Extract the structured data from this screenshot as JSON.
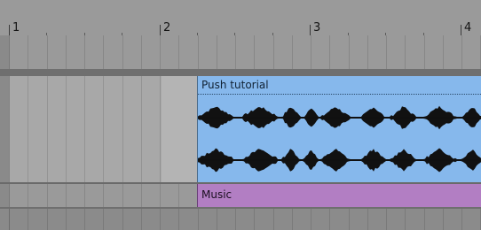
{
  "ruler": {
    "bars": [
      "1",
      "2",
      "3",
      "4"
    ]
  },
  "clips": {
    "audio": {
      "name": "Push tutorial",
      "color": "#86b8ec"
    },
    "midi": {
      "name": "Music",
      "color": "#b27ec3"
    }
  },
  "colors": {
    "background": "#8f8f8f",
    "waveform": "#111111"
  }
}
